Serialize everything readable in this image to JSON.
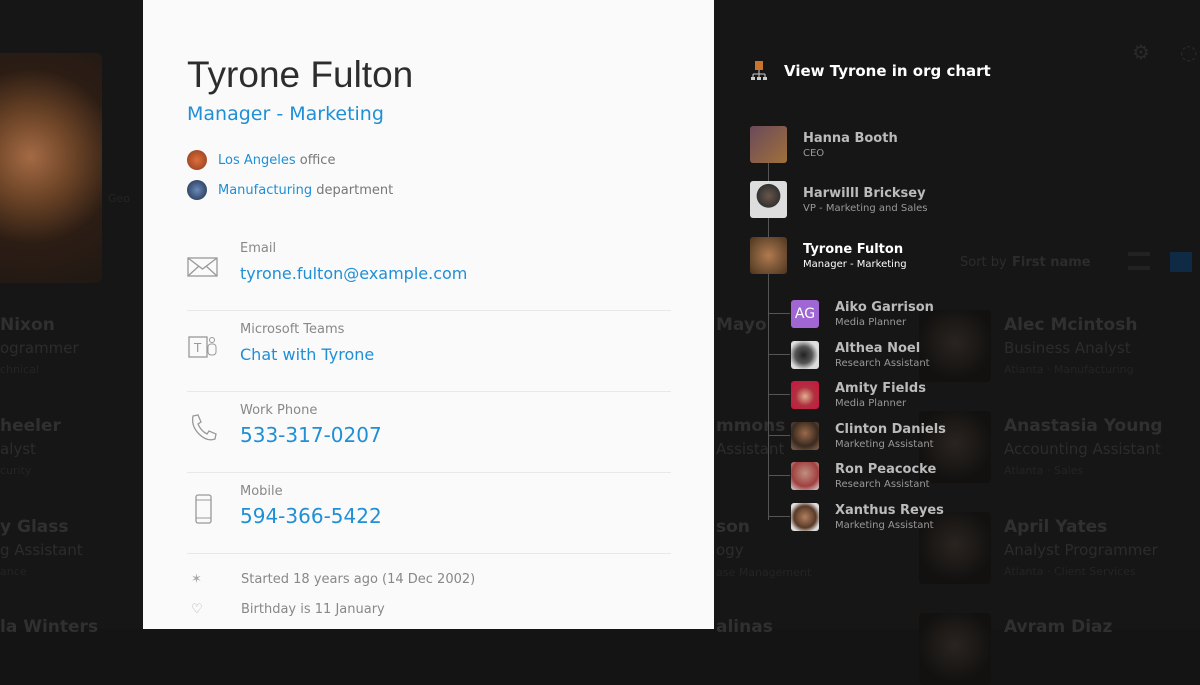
{
  "background": {
    "left_cards": [
      {
        "name": "Nixon",
        "title": "ogrammer",
        "sub": "chnical"
      },
      {
        "name": "heeler",
        "title": "alyst",
        "sub": "curity"
      },
      {
        "name": "y Glass",
        "title": "g Assistant",
        "sub": "ance"
      },
      {
        "name": "la Winters"
      }
    ],
    "middle_cards": [
      {
        "name": "Mayo"
      },
      {
        "name": "mmons",
        "title": "Assistant"
      },
      {
        "name": "son",
        "title": "ogy",
        "sub": "ase Management"
      },
      {
        "name": "alinas"
      }
    ],
    "right_cards": [
      {
        "name": "Alec Mcintosh",
        "title": "Business Analyst",
        "sub": "Atlanta · Manufacturing"
      },
      {
        "name": "Anastasia Young",
        "title": "Accounting Assistant",
        "sub": "Atlanta · Sales"
      },
      {
        "name": "April Yates",
        "title": "Analyst Programmer",
        "sub": "Atlanta · Client Services"
      },
      {
        "name": "Avram Diaz"
      }
    ],
    "sort_label": "Sort by",
    "sort_value": "First name",
    "geo_fragment": "Geo"
  },
  "profile": {
    "name": "Tyrone Fulton",
    "role": "Manager - Marketing",
    "office_link": "Los Angeles",
    "office_suffix": "office",
    "department_link": "Manufacturing",
    "department_suffix": "department",
    "contacts": [
      {
        "label": "Email",
        "value": "tyrone.fulton@example.com",
        "icon": "envelope-icon"
      },
      {
        "label": "Microsoft Teams",
        "value": "Chat with Tyrone",
        "icon": "teams-icon"
      },
      {
        "label": "Work Phone",
        "value": "533-317-0207",
        "icon": "phone-icon"
      },
      {
        "label": "Mobile",
        "value": "594-366-5422",
        "icon": "mobile-icon"
      }
    ],
    "started": "Started 18 years ago (14 Dec 2002)",
    "birthday": "Birthday is 11 January"
  },
  "org": {
    "title": "View Tyrone in org chart",
    "chain": [
      {
        "name": "Hanna Booth",
        "title": "CEO"
      },
      {
        "name": "Harwilll Bricksey",
        "title": "VP - Marketing and Sales"
      },
      {
        "name": "Tyrone Fulton",
        "title": "Manager - Marketing"
      }
    ],
    "reports": [
      {
        "name": "Aiko Garrison",
        "title": "Media Planner",
        "initials": "AG"
      },
      {
        "name": "Althea Noel",
        "title": "Research Assistant"
      },
      {
        "name": "Amity Fields",
        "title": "Media Planner"
      },
      {
        "name": "Clinton Daniels",
        "title": "Marketing Assistant"
      },
      {
        "name": "Ron Peacocke",
        "title": "Research Assistant"
      },
      {
        "name": "Xanthus Reyes",
        "title": "Marketing Assistant"
      }
    ]
  },
  "colors": {
    "accent": "#1f8fd6",
    "initials_bg": "#a066d3"
  }
}
